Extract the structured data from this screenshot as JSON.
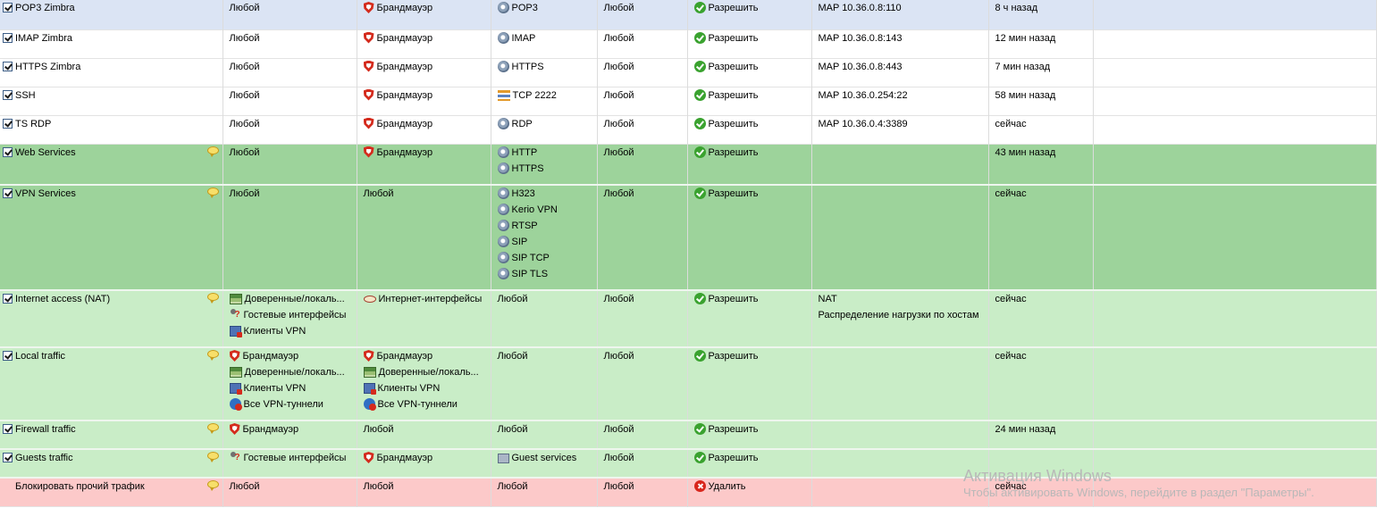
{
  "rules": [
    {
      "name": "POP3 Zimbra",
      "checked": true,
      "comment": false,
      "style": "selected",
      "height": 33,
      "source": [
        {
          "icon": "",
          "label": "Любой"
        }
      ],
      "destination": [
        {
          "icon": "firewall-icon",
          "label": "Брандмауэр"
        }
      ],
      "service": [
        {
          "icon": "gear-icon",
          "label": "POP3"
        }
      ],
      "time": "Любой",
      "action": {
        "icon": "allow-icon",
        "label": "Разрешить"
      },
      "translation": [
        "MAP 10.36.0.8:110"
      ],
      "last_used": "8 ч назад"
    },
    {
      "name": "IMAP Zimbra",
      "checked": true,
      "comment": false,
      "style": "plain",
      "height": 32,
      "source": [
        {
          "icon": "",
          "label": "Любой"
        }
      ],
      "destination": [
        {
          "icon": "firewall-icon",
          "label": "Брандмауэр"
        }
      ],
      "service": [
        {
          "icon": "gear-icon",
          "label": "IMAP"
        }
      ],
      "time": "Любой",
      "action": {
        "icon": "allow-icon",
        "label": "Разрешить"
      },
      "translation": [
        "MAP 10.36.0.8:143"
      ],
      "last_used": "12 мин назад"
    },
    {
      "name": "HTTPS Zimbra",
      "checked": true,
      "comment": false,
      "style": "plain",
      "height": 32,
      "source": [
        {
          "icon": "",
          "label": "Любой"
        }
      ],
      "destination": [
        {
          "icon": "firewall-icon",
          "label": "Брандмауэр"
        }
      ],
      "service": [
        {
          "icon": "gear-icon",
          "label": "HTTPS"
        }
      ],
      "time": "Любой",
      "action": {
        "icon": "allow-icon",
        "label": "Разрешить"
      },
      "translation": [
        "MAP 10.36.0.8:443"
      ],
      "last_used": "7 мин назад"
    },
    {
      "name": "SSH",
      "checked": true,
      "comment": false,
      "style": "plain",
      "height": 32,
      "source": [
        {
          "icon": "",
          "label": "Любой"
        }
      ],
      "destination": [
        {
          "icon": "firewall-icon",
          "label": "Брандмауэр"
        }
      ],
      "service": [
        {
          "icon": "tcp-icon",
          "label": "TCP 2222"
        }
      ],
      "time": "Любой",
      "action": {
        "icon": "allow-icon",
        "label": "Разрешить"
      },
      "translation": [
        "MAP 10.36.0.254:22"
      ],
      "last_used": "58 мин назад"
    },
    {
      "name": "TS RDP",
      "checked": true,
      "comment": false,
      "style": "plain",
      "height": 32,
      "source": [
        {
          "icon": "",
          "label": "Любой"
        }
      ],
      "destination": [
        {
          "icon": "firewall-icon",
          "label": "Брандмауэр"
        }
      ],
      "service": [
        {
          "icon": "gear-icon",
          "label": "RDP"
        }
      ],
      "time": "Любой",
      "action": {
        "icon": "allow-icon",
        "label": "Разрешить"
      },
      "translation": [
        "MAP 10.36.0.4:3389"
      ],
      "last_used": "сейчас"
    },
    {
      "name": "Web Services",
      "checked": true,
      "comment": true,
      "style": "green-dark",
      "height": 46,
      "source": [
        {
          "icon": "",
          "label": "Любой"
        }
      ],
      "destination": [
        {
          "icon": "firewall-icon",
          "label": "Брандмауэр"
        }
      ],
      "service": [
        {
          "icon": "gear-icon",
          "label": "HTTP"
        },
        {
          "icon": "gear-icon",
          "label": "HTTPS"
        }
      ],
      "time": "Любой",
      "action": {
        "icon": "allow-icon",
        "label": "Разрешить"
      },
      "translation": [],
      "last_used": "43 мин назад"
    },
    {
      "name": "VPN Services",
      "checked": true,
      "comment": true,
      "style": "green-dark",
      "height": 118,
      "source": [
        {
          "icon": "",
          "label": "Любой"
        }
      ],
      "destination": [
        {
          "icon": "",
          "label": "Любой"
        }
      ],
      "service": [
        {
          "icon": "gear-icon",
          "label": "H323"
        },
        {
          "icon": "gear-icon",
          "label": "Kerio VPN"
        },
        {
          "icon": "gear-icon",
          "label": "RTSP"
        },
        {
          "icon": "gear-icon",
          "label": "SIP"
        },
        {
          "icon": "gear-icon",
          "label": "SIP TCP"
        },
        {
          "icon": "gear-icon",
          "label": "SIP TLS"
        }
      ],
      "time": "Любой",
      "action": {
        "icon": "allow-icon",
        "label": "Разрешить"
      },
      "translation": [],
      "last_used": "сейчас"
    },
    {
      "name": "Internet access (NAT)",
      "checked": true,
      "comment": true,
      "style": "green-light",
      "height": 64,
      "source": [
        {
          "icon": "trusted-icon",
          "label": "Доверенные/локаль..."
        },
        {
          "icon": "guest-icon",
          "label": "Гостевые интерфейсы"
        },
        {
          "icon": "vpn-clients-icon",
          "label": "Клиенты VPN"
        }
      ],
      "destination": [
        {
          "icon": "internet-interfaces-icon",
          "label": "Интернет-интерфейсы"
        }
      ],
      "service": [
        {
          "icon": "",
          "label": "Любой"
        }
      ],
      "time": "Любой",
      "action": {
        "icon": "allow-icon",
        "label": "Разрешить"
      },
      "translation": [
        "NAT",
        "Распределение нагрузки по хостам"
      ],
      "last_used": "сейчас"
    },
    {
      "name": "Local traffic",
      "checked": true,
      "comment": true,
      "style": "green-light",
      "height": 82,
      "source": [
        {
          "icon": "firewall-icon",
          "label": "Брандмауэр"
        },
        {
          "icon": "trusted-icon",
          "label": "Доверенные/локаль..."
        },
        {
          "icon": "vpn-clients-icon",
          "label": "Клиенты VPN"
        },
        {
          "icon": "vpn-tunnels-icon",
          "label": "Все VPN-туннели"
        }
      ],
      "destination": [
        {
          "icon": "firewall-icon",
          "label": "Брандмауэр"
        },
        {
          "icon": "trusted-icon",
          "label": "Доверенные/локаль..."
        },
        {
          "icon": "vpn-clients-icon",
          "label": "Клиенты VPN"
        },
        {
          "icon": "vpn-tunnels-icon",
          "label": "Все VPN-туннели"
        }
      ],
      "service": [
        {
          "icon": "",
          "label": "Любой"
        }
      ],
      "time": "Любой",
      "action": {
        "icon": "allow-icon",
        "label": "Разрешить"
      },
      "translation": [],
      "last_used": "сейчас"
    },
    {
      "name": "Firewall traffic",
      "checked": true,
      "comment": true,
      "style": "green-light",
      "height": 32,
      "source": [
        {
          "icon": "firewall-icon",
          "label": "Брандмауэр"
        }
      ],
      "destination": [
        {
          "icon": "",
          "label": "Любой"
        }
      ],
      "service": [
        {
          "icon": "",
          "label": "Любой"
        }
      ],
      "time": "Любой",
      "action": {
        "icon": "allow-icon",
        "label": "Разрешить"
      },
      "translation": [],
      "last_used": "24 мин назад"
    },
    {
      "name": "Guests traffic",
      "checked": true,
      "comment": true,
      "style": "green-light",
      "height": 32,
      "source": [
        {
          "icon": "guest-icon",
          "label": "Гостевые интерфейсы"
        }
      ],
      "destination": [
        {
          "icon": "firewall-icon",
          "label": "Брандмауэр"
        }
      ],
      "service": [
        {
          "icon": "guest-services-icon",
          "label": "Guest services"
        }
      ],
      "time": "Любой",
      "action": {
        "icon": "allow-icon",
        "label": "Разрешить"
      },
      "translation": [],
      "last_used": ""
    },
    {
      "name": "Блокировать прочий трафик",
      "checked": false,
      "comment": true,
      "style": "red",
      "height": 32,
      "source": [
        {
          "icon": "",
          "label": "Любой"
        }
      ],
      "destination": [
        {
          "icon": "",
          "label": "Любой"
        }
      ],
      "service": [
        {
          "icon": "",
          "label": "Любой"
        }
      ],
      "time": "Любой",
      "action": {
        "icon": "drop-icon",
        "label": "Удалить"
      },
      "translation": [],
      "last_used": "сейчас"
    }
  ],
  "watermark": {
    "title": "Активация Windows",
    "subtitle": "Чтобы активировать Windows, перейдите в раздел \"Параметры\"."
  }
}
